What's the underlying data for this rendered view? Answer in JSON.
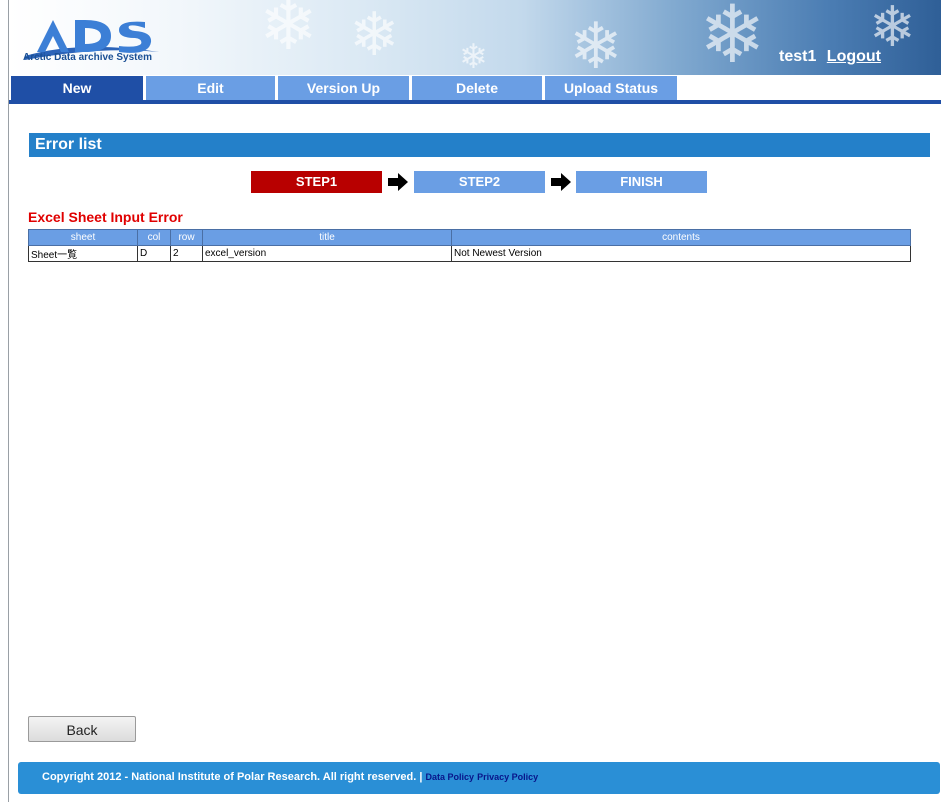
{
  "app": {
    "logo_text": "ADS",
    "logo_caption": "Arctic Data archive System"
  },
  "user": {
    "name": "test1",
    "logout_label": "Logout"
  },
  "tabs": [
    {
      "label": "New",
      "active": true
    },
    {
      "label": "Edit",
      "active": false
    },
    {
      "label": "Version Up",
      "active": false
    },
    {
      "label": "Delete",
      "active": false
    },
    {
      "label": "Upload Status",
      "active": false
    }
  ],
  "section": {
    "title": "Error list"
  },
  "steps": [
    {
      "label": "STEP1",
      "current": true
    },
    {
      "label": "STEP2",
      "current": false
    },
    {
      "label": "FINISH",
      "current": false
    }
  ],
  "error_section": {
    "heading": "Excel Sheet Input Error",
    "columns": [
      "sheet",
      "col",
      "row",
      "title",
      "contents"
    ],
    "rows": [
      {
        "sheet": "Sheet一覧",
        "col": "D",
        "row": "2",
        "title": "excel_version",
        "contents": "Not Newest Version"
      }
    ]
  },
  "actions": {
    "back_label": "Back"
  },
  "footer": {
    "copyright": "Copyright 2012 - National Institute of Polar Research. All right reserved. |",
    "data_policy": "Data Policy",
    "privacy_policy": "Privacy Policy"
  },
  "colors": {
    "tab": "#6a9ee4",
    "tab_active": "#1f4fa6",
    "section_bar": "#2480c9",
    "step_current": "#b80000",
    "error_heading": "#e00000",
    "footer": "#2a8fd6"
  }
}
